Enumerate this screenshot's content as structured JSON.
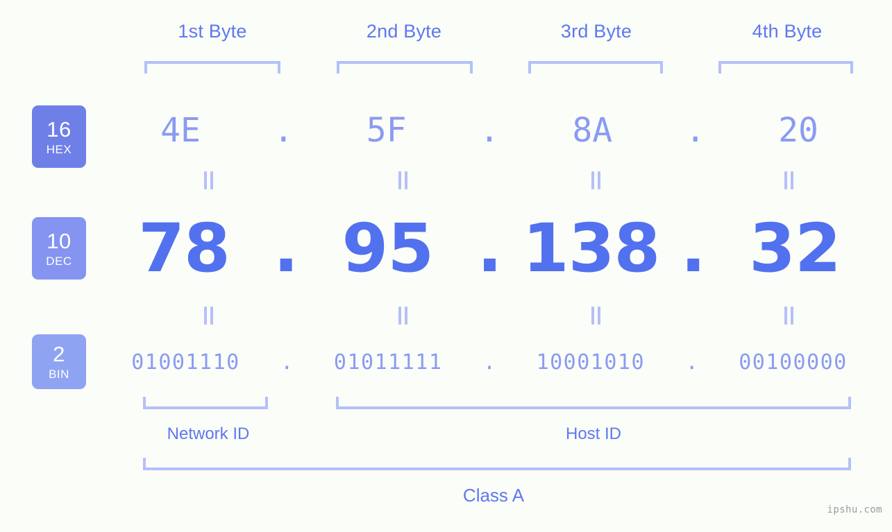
{
  "watermark": "ipshu.com",
  "byte_headers": [
    {
      "label": "1st Byte"
    },
    {
      "label": "2nd Byte"
    },
    {
      "label": "3rd Byte"
    },
    {
      "label": "4th Byte"
    }
  ],
  "bases": {
    "hex": {
      "number": "16",
      "abbr": "HEX",
      "color": "#6f7fe8"
    },
    "dec": {
      "number": "10",
      "abbr": "DEC",
      "color": "#8494f0"
    },
    "bin": {
      "number": "2",
      "abbr": "BIN",
      "color": "#8ea4f2"
    }
  },
  "separator": ".",
  "rows": {
    "hex": {
      "values": [
        "4E",
        "5F",
        "8A",
        "20"
      ]
    },
    "dec": {
      "values": [
        "78",
        "95",
        "138",
        "32"
      ]
    },
    "bin": {
      "values": [
        "01001110",
        "01011111",
        "10001010",
        "00100000"
      ]
    }
  },
  "sections": {
    "network_id": "Network ID",
    "host_id": "Host ID",
    "class": "Class A"
  },
  "colors": {
    "background": "#fbfdf8",
    "bracket": "#b4c0fa",
    "label_text": "#5e78f0",
    "hex_text": "#8a9bf2",
    "dec_text": "#5271ef",
    "bin_text": "#8a9bf2",
    "watermark_text": "#9b9b9b"
  }
}
